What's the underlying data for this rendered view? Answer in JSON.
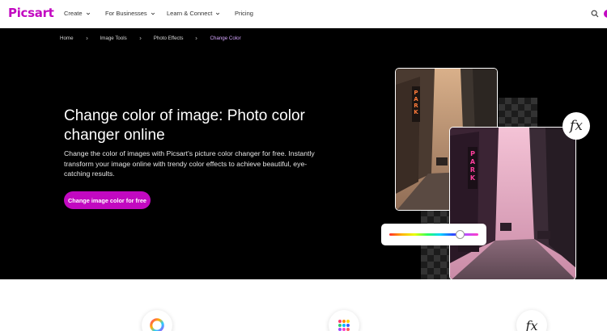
{
  "nav": {
    "logo": "Picsart",
    "items": [
      {
        "label": "Create",
        "has_dropdown": true
      },
      {
        "label": "For Businesses",
        "has_dropdown": true
      },
      {
        "label": "Learn & Connect",
        "has_dropdown": true
      },
      {
        "label": "Pricing",
        "has_dropdown": false
      }
    ],
    "search_icon": "search-icon"
  },
  "breadcrumb": [
    "Home",
    "Image Tools",
    "Photo Effects",
    "Change Color"
  ],
  "hero": {
    "title": "Change color of image: Photo color changer online",
    "description": "Change the color of images with Picsart's picture color changer for free. Instantly transform your image online with trendy color effects to achieve beautiful, eye-catching results.",
    "cta": "Change image color for free",
    "fx_badge": "fx",
    "photo_sign": "PARK"
  },
  "features": {
    "icons": [
      "color-wheel-icon",
      "palette-dots-icon",
      "fx-icon"
    ],
    "fx_label": "fx"
  },
  "colors": {
    "brand": "#c209c1",
    "hero_bg": "#000000",
    "breadcrumb_active": "#d6a6ff"
  }
}
